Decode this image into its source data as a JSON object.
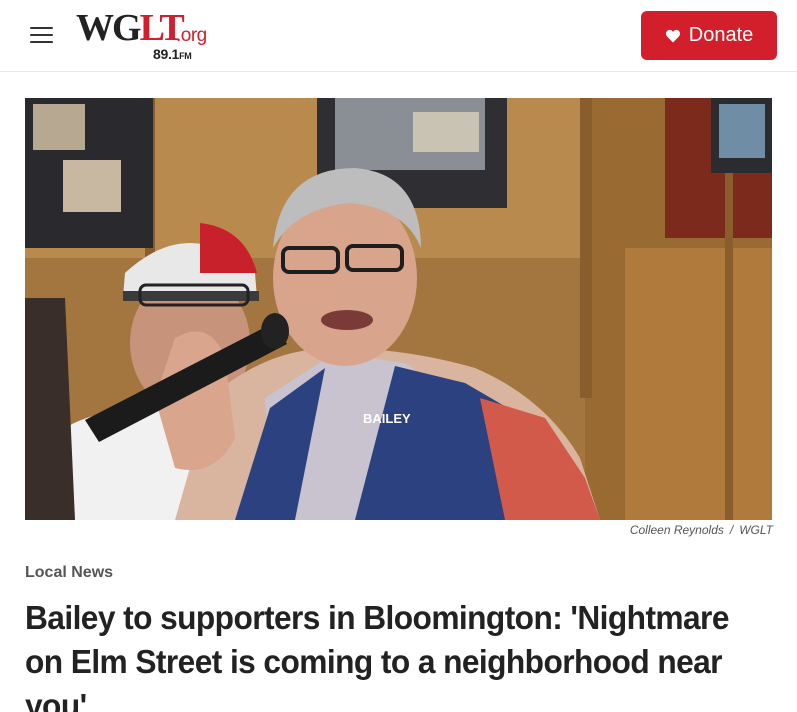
{
  "header": {
    "menu_icon": "hamburger-menu-icon",
    "logo": {
      "main_dark": "WG",
      "main_red": "LT",
      "suffix": ".org",
      "frequency": "89.1",
      "band": "FM"
    },
    "donate": {
      "label": "Donate",
      "icon": "heart-icon",
      "color": "#d21f2b"
    }
  },
  "article": {
    "photo_credit": {
      "author": "Colleen Reynolds",
      "separator": "/",
      "org": "WGLT"
    },
    "section": "Local News",
    "headline": "Bailey to supporters in Bloomington: 'Nightmare on Elm Street is coming to a neighborhood near you'"
  },
  "colors": {
    "brand_red": "#d21f2b",
    "text": "#222222"
  }
}
